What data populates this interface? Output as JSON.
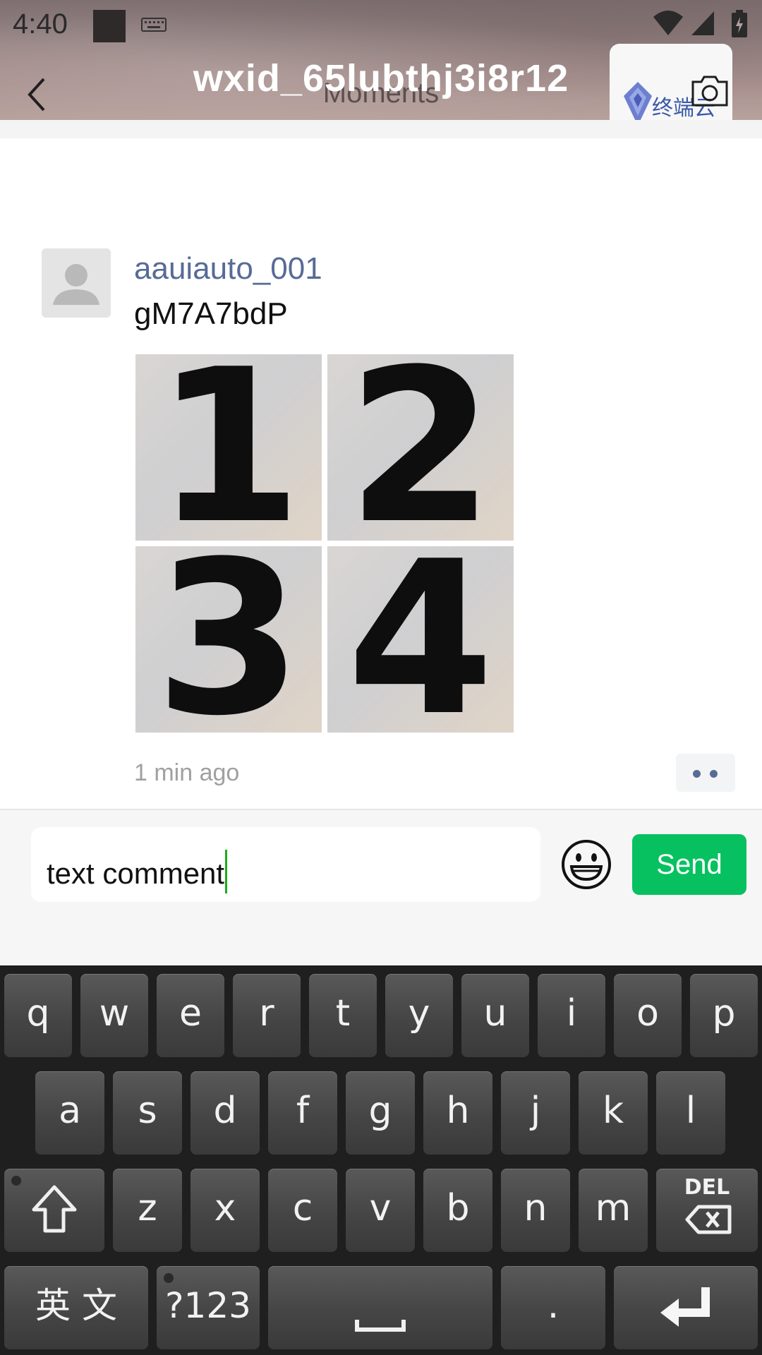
{
  "status_bar": {
    "time": "4:40"
  },
  "header": {
    "title": "wxid_65lubthj3i8r12",
    "subtitle": "Moments",
    "badge_text": "终端云测"
  },
  "post": {
    "author": "aauiauto_001",
    "text": "gM7A7bdP",
    "photos": [
      "1",
      "2",
      "3",
      "4"
    ],
    "timestamp": "1 min ago"
  },
  "comment": {
    "value": "text comment",
    "send_label": "Send"
  },
  "keyboard": {
    "row1": [
      "q",
      "w",
      "e",
      "r",
      "t",
      "y",
      "u",
      "i",
      "o",
      "p"
    ],
    "row2": [
      "a",
      "s",
      "d",
      "f",
      "g",
      "h",
      "j",
      "k",
      "l"
    ],
    "row3": [
      "z",
      "x",
      "c",
      "v",
      "b",
      "n",
      "m"
    ],
    "delete_label": "DEL",
    "lang_label": "英 文",
    "symbols_label": "?123",
    "period_label": "."
  },
  "colors": {
    "link_blue": "#576b95",
    "send_green": "#07c160",
    "caret_green": "#1aad19"
  },
  "icons": [
    "back-arrow-icon",
    "camera-icon",
    "emoji-icon",
    "shift-icon",
    "delete-icon",
    "space-icon",
    "enter-icon",
    "wifi-icon",
    "cellular-icon",
    "battery-icon",
    "keyboard-icon"
  ]
}
